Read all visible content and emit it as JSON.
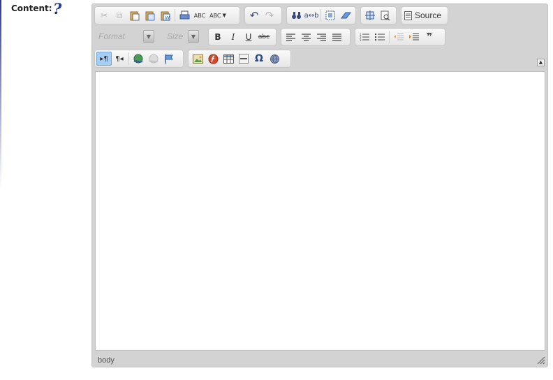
{
  "field": {
    "label": "Content:",
    "help_icon": "question-mark-icon"
  },
  "toolbar": {
    "format_placeholder": "Format",
    "size_placeholder": "Size",
    "source_label": "Source",
    "bold": "B",
    "italic": "I",
    "underline": "U",
    "strike": "abc",
    "spell": "ABC",
    "spell2": "ABC",
    "ltr": "▸¶",
    "rtl": "¶◂",
    "special_char": "Ω",
    "quote": "❞"
  },
  "statusbar": {
    "path": "body"
  }
}
